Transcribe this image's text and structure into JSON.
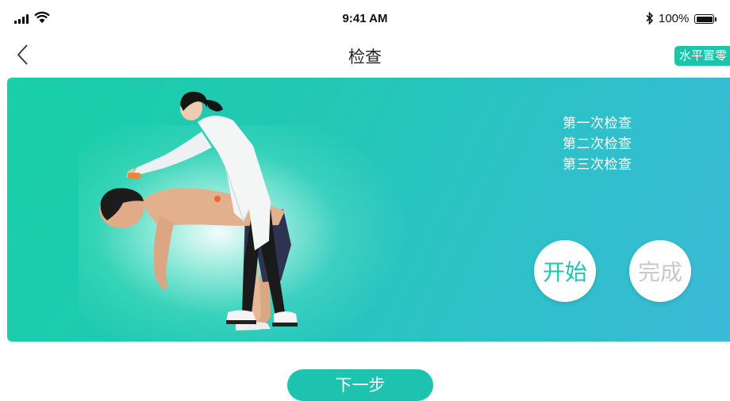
{
  "status_bar": {
    "time": "9:41 AM",
    "battery": "100%"
  },
  "nav": {
    "title": "检查",
    "zero_button": "水平置零"
  },
  "checks": [
    "第一次检查",
    "第二次检查",
    "第三次检查"
  ],
  "actions": {
    "start": "开始",
    "done": "完成"
  },
  "footer": {
    "next": "下一步"
  },
  "colors": {
    "accent": "#1ec3b0",
    "gradient_start": "#19cfa9",
    "gradient_end": "#3bb9d8",
    "disabled_text": "#c9c9c9"
  },
  "icons": [
    "signal-icon",
    "wifi-icon",
    "bluetooth-icon",
    "battery-icon",
    "back-chevron-icon"
  ]
}
